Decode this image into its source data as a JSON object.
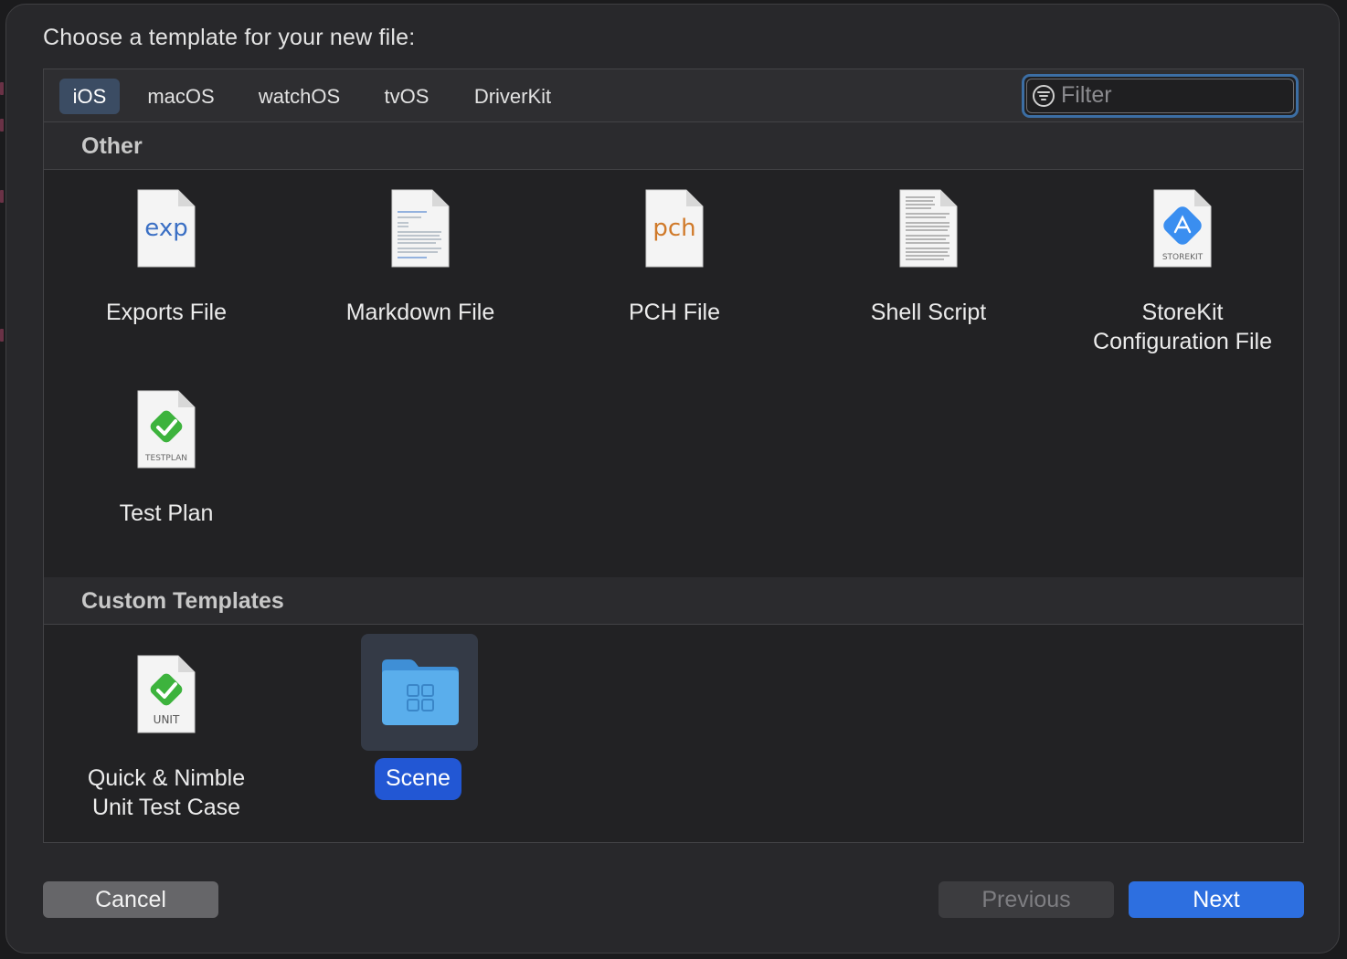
{
  "dialog": {
    "title": "Choose a template for your new file:"
  },
  "tabs": [
    {
      "label": "iOS",
      "active": true
    },
    {
      "label": "macOS",
      "active": false
    },
    {
      "label": "watchOS",
      "active": false
    },
    {
      "label": "tvOS",
      "active": false
    },
    {
      "label": "DriverKit",
      "active": false
    }
  ],
  "filter": {
    "placeholder": "Filter",
    "value": ""
  },
  "sections": [
    {
      "title": "Other",
      "items": [
        {
          "label": "Exports File",
          "icon": "exp-file-icon",
          "glyph": "exp"
        },
        {
          "label": "Markdown File",
          "icon": "markdown-file-icon"
        },
        {
          "label": "PCH File",
          "icon": "pch-file-icon",
          "glyph": "pch"
        },
        {
          "label": "Shell Script",
          "icon": "shell-script-icon"
        },
        {
          "label_line1": "StoreKit",
          "label_line2": "Configuration File",
          "icon": "storekit-file-icon",
          "glyph": "STOREKIT"
        },
        {
          "label": "Test Plan",
          "icon": "testplan-file-icon",
          "glyph": "TESTPLAN"
        }
      ]
    },
    {
      "title": "Custom Templates",
      "items": [
        {
          "label_line1": "Quick & Nimble",
          "label_line2": "Unit Test Case",
          "icon": "unit-test-file-icon",
          "glyph": "UNIT"
        },
        {
          "label": "Scene",
          "icon": "folder-icon",
          "selected": true
        }
      ]
    }
  ],
  "buttons": {
    "cancel": "Cancel",
    "previous": "Previous",
    "next": "Next"
  },
  "colors": {
    "accent": "#2d6fe0",
    "selection": "#2257d4",
    "check": "#3db33d",
    "exp": "#3a6fc4",
    "pch": "#d07a2a"
  }
}
